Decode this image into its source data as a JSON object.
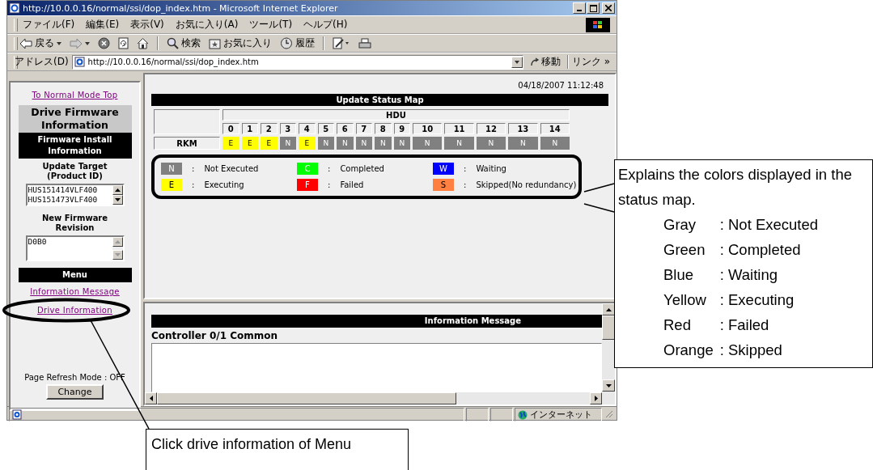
{
  "window": {
    "title": "http://10.0.0.16/normal/ssi/dop_index.htm - Microsoft Internet Explorer"
  },
  "menu_bar": [
    "ファイル(F)",
    "編集(E)",
    "表示(V)",
    "お気に入り(A)",
    "ツール(T)",
    "ヘルプ(H)"
  ],
  "toolbar": [
    {
      "kind": "back",
      "label": "戻る"
    },
    {
      "kind": "forward"
    },
    {
      "kind": "stop"
    },
    {
      "kind": "refresh"
    },
    {
      "kind": "home"
    },
    {
      "kind": "search",
      "label": "検索"
    },
    {
      "kind": "favorites",
      "label": "お気に入り"
    },
    {
      "kind": "history",
      "label": "履歴"
    },
    {
      "kind": "edit"
    },
    {
      "kind": "print"
    }
  ],
  "address_bar": {
    "label": "アドレス(D)",
    "value": "http://10.0.0.16/normal/ssi/dop_index.htm",
    "go": "移動",
    "links": "リンク »"
  },
  "sidebar": {
    "top_link": "To Normal Mode Top",
    "title": "Drive Firmware Information",
    "section": "Firmware Install Information",
    "target_label": "Update Target (Product ID)",
    "targets": [
      "HUS151414VLF400",
      "HUS151473VLF400"
    ],
    "revision_label": "New Firmware Revision",
    "revision": "D0B0",
    "menu_title": "Menu",
    "menu": [
      "Information Message",
      "Drive Information"
    ],
    "refresh": "Page Refresh Mode : OFF",
    "change": "Change"
  },
  "status_map": {
    "timestamp": "04/18/2007 11:12:48",
    "title": "Update Status Map",
    "group": "HDU",
    "columns": [
      "0",
      "1",
      "2",
      "3",
      "4",
      "5",
      "6",
      "7",
      "8",
      "9",
      "10",
      "11",
      "12",
      "13",
      "14"
    ],
    "rows": [
      {
        "label": "RKM",
        "cells": [
          {
            "text": "E",
            "color": "#ffff00"
          },
          {
            "text": "E",
            "color": "#ffff00"
          },
          {
            "text": "E",
            "color": "#ffff00"
          },
          {
            "text": "N",
            "color": "#808080"
          },
          {
            "text": "E",
            "color": "#ffff00"
          },
          {
            "text": "N",
            "color": "#808080"
          },
          {
            "text": "N",
            "color": "#808080"
          },
          {
            "text": "N",
            "color": "#808080"
          },
          {
            "text": "N",
            "color": "#808080"
          },
          {
            "text": "N",
            "color": "#808080"
          },
          {
            "text": "N",
            "color": "#808080"
          },
          {
            "text": "N",
            "color": "#808080"
          },
          {
            "text": "N",
            "color": "#808080"
          },
          {
            "text": "N",
            "color": "#808080"
          },
          {
            "text": "N",
            "color": "#808080"
          }
        ]
      }
    ],
    "legend": [
      {
        "code": "N",
        "separator": ":",
        "label": "Not Executed",
        "color": "#808080"
      },
      {
        "code": "C",
        "separator": ":",
        "label": "Completed",
        "color": "#00ff00"
      },
      {
        "code": "W",
        "separator": ":",
        "label": "Waiting",
        "color": "#0000ff"
      },
      {
        "code": "E",
        "separator": ":",
        "label": "Executing",
        "color": "#ffff00"
      },
      {
        "code": "F",
        "separator": ":",
        "label": "Failed",
        "color": "#ff0000"
      },
      {
        "code": "S",
        "separator": ":",
        "label": "Skipped(No redundancy)",
        "color": "#ff8040"
      }
    ]
  },
  "info": {
    "title": "Information Message",
    "subtitle": "Controller 0/1 Common"
  },
  "status_bar": {
    "zone": "インターネット"
  },
  "callouts": [
    {
      "kind": "legend",
      "text": "Explains the colors displayed in the status map.",
      "lines": [
        {
          "name": "Gray",
          "meaning": ": Not Executed"
        },
        {
          "name": "Green",
          "meaning": ": Completed"
        },
        {
          "name": "Blue",
          "meaning": ": Waiting"
        },
        {
          "name": "Yellow",
          "meaning": ": Executing"
        },
        {
          "name": "Red",
          "meaning": ": Failed"
        },
        {
          "name": "Orange",
          "meaning": ": Skipped"
        }
      ]
    },
    {
      "kind": "click",
      "text": "Click drive information of Menu"
    }
  ]
}
